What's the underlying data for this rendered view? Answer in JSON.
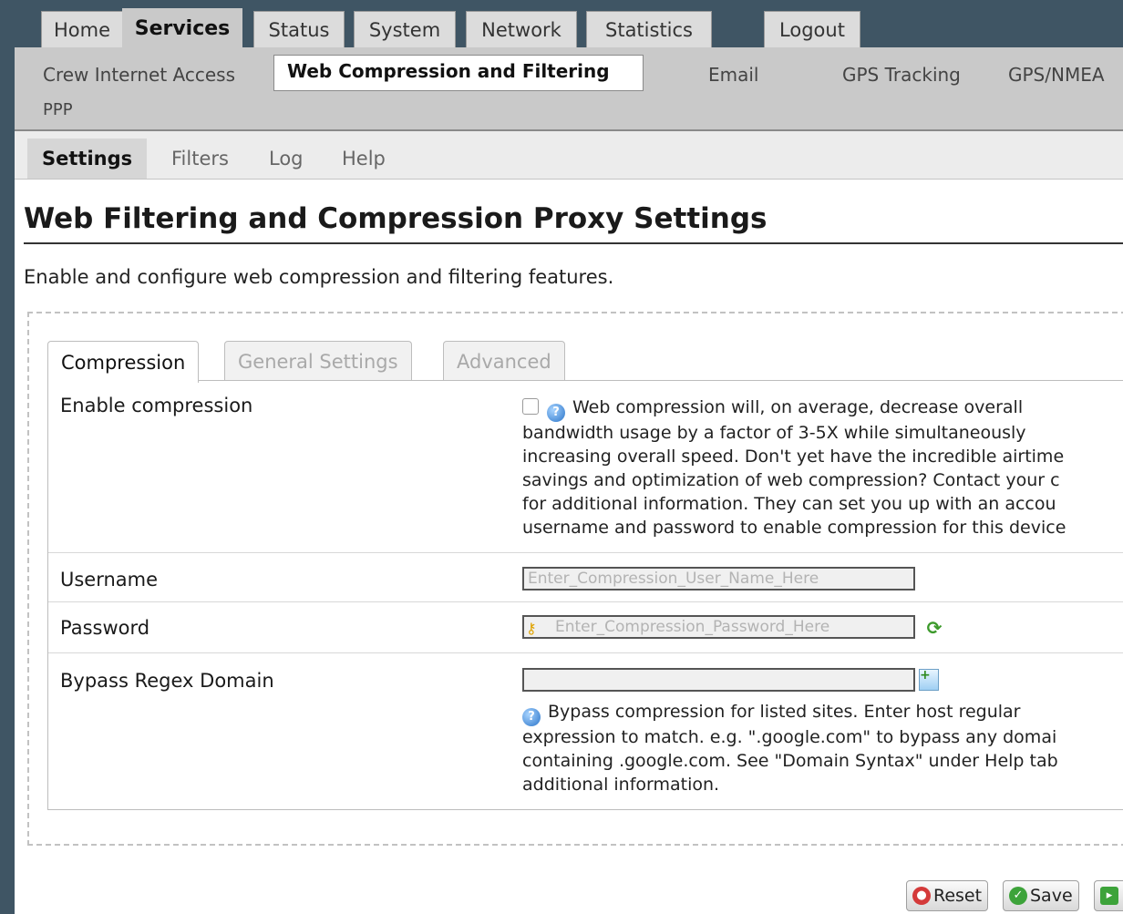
{
  "main_tabs": [
    "Home",
    "Services",
    "Status",
    "System",
    "Network",
    "Statistics",
    "Logout"
  ],
  "active_main_tab": "Services",
  "sub_tabs": [
    "Crew Internet Access",
    "Web Compression and Filtering",
    "Email",
    "GPS Tracking",
    "GPS/NMEA",
    "PPP"
  ],
  "active_sub_tab": "Web Compression and Filtering",
  "inner_tabs": [
    "Settings",
    "Filters",
    "Log",
    "Help"
  ],
  "active_inner_tab": "Settings",
  "page": {
    "title": "Web Filtering and Compression Proxy Settings",
    "description": "Enable and configure web compression and filtering features."
  },
  "panel_tabs": [
    "Compression",
    "General Settings",
    "Advanced"
  ],
  "active_panel_tab": "Compression",
  "form": {
    "enable_compression": {
      "label": "Enable compression",
      "checked": false,
      "help_lines": [
        "Web compression will, on average, decrease overall",
        "bandwidth usage by a factor of 3-5X while simultaneously",
        "increasing overall speed. Don't yet have the incredible airtime",
        "savings and optimization of web compression? Contact your c",
        "for additional information. They can set you up with an accou",
        "username and password to enable compression for this device"
      ]
    },
    "username": {
      "label": "Username",
      "placeholder": "Enter_Compression_User_Name_Here",
      "value": ""
    },
    "password": {
      "label": "Password",
      "placeholder": "Enter_Compression_Password_Here",
      "value": ""
    },
    "bypass": {
      "label": "Bypass Regex Domain",
      "value": "",
      "help_lines": [
        "Bypass compression for listed sites. Enter host regular",
        "expression to match. e.g. \".google.com\" to bypass any domai",
        "containing .google.com. See \"Domain Syntax\" under Help tab",
        "additional information."
      ]
    }
  },
  "buttons": {
    "reset": "Reset",
    "save": "Save"
  },
  "colors": {
    "header_bg": "#3f5564",
    "tab_active": "#c9c9c9",
    "info_blue": "#2a74c9",
    "reset_red": "#d43a3a",
    "save_green": "#3da33a"
  }
}
